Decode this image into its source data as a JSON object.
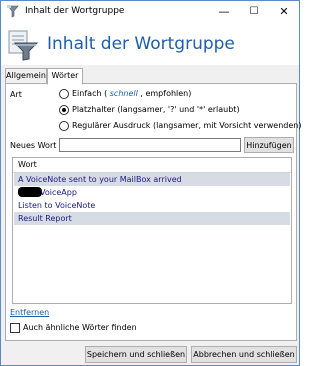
{
  "window": {
    "title": "Inhalt der Wortgruppe",
    "controls": {
      "minimize": "—",
      "maximize": "☐",
      "close": "✕"
    }
  },
  "header": {
    "title": "Inhalt der Wortgruppe"
  },
  "tabs": [
    {
      "label": "Allgemein",
      "active": false
    },
    {
      "label": "Wörter",
      "active": true
    }
  ],
  "art": {
    "label": "Art",
    "options": [
      {
        "pre": "Einfach (",
        "em": " schnell ",
        "post": ", empfohlen)",
        "checked": false
      },
      {
        "text": "Platzhalter (langsamer, '?' und '*' erlaubt)",
        "checked": true
      },
      {
        "text": "Regulärer Ausdruck (langsamer, mit Vorsicht verwenden)",
        "checked": false
      }
    ]
  },
  "new_word": {
    "label": "Neues Wort",
    "value": "",
    "add_button": "Hinzufügen"
  },
  "list": {
    "header": "Wort",
    "rows": [
      {
        "text": "A VoiceNote sent to your MailBox arrived",
        "selected": true,
        "redacted_prefix": false
      },
      {
        "text": "VoiceApp",
        "selected": false,
        "redacted_prefix": true
      },
      {
        "text": "Listen to VoiceNote",
        "selected": false,
        "redacted_prefix": false
      },
      {
        "text": "Result Report",
        "selected": true,
        "redacted_prefix": false
      }
    ]
  },
  "remove_link": "Entfernen",
  "similar_checkbox": {
    "label": "Auch ähnliche Wörter finden",
    "checked": false
  },
  "footer": {
    "save_close": "Speichern und schließen",
    "cancel_close": "Abbrechen und schließen"
  },
  "colors": {
    "accent": "#1f5ea8",
    "selection": "#d7dbe3",
    "window_border": "#5a8bc9"
  }
}
